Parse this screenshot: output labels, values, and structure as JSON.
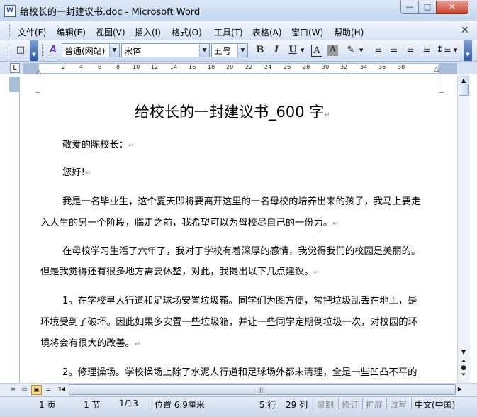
{
  "window": {
    "title": "给校长的一封建议书.doc - Microsoft Word",
    "app_icon": "W",
    "controls": {
      "minimize": "—",
      "maximize": "□",
      "close": "✕"
    }
  },
  "menubar": {
    "items": [
      "文件(F)",
      "编辑(E)",
      "视图(V)",
      "插入(I)",
      "格式(O)",
      "工具(T)",
      "表格(A)",
      "窗口(W)",
      "帮助(H)"
    ],
    "close_doc": "✕"
  },
  "toolbar": {
    "style_value": "普通(网站)",
    "font_value": "宋体",
    "size_value": "五号",
    "new_icon": "□",
    "styles_icon": "A",
    "bold": "B",
    "italic": "I",
    "underline": "U",
    "char_border": "A",
    "char_shading": "A",
    "highlight": "✎",
    "align_left": "≡",
    "align_center": "≡",
    "align_right": "≡",
    "justify": "≡",
    "line_spacing": "↕≡"
  },
  "ruler": {
    "ticks": [
      "2",
      "4",
      "6",
      "8",
      "10",
      "12",
      "14",
      "16",
      "18",
      "20",
      "22",
      "24",
      "26",
      "28",
      "30",
      "32",
      "34",
      "36",
      "38"
    ],
    "corner": "L"
  },
  "document": {
    "title": "给校长的一封建议书_600 字",
    "paragraphs": [
      "敬爱的陈校长：",
      "您好!",
      "我是一名毕业生，这个夏天即将要离开这里的一名母校的培养出来的孩子，我马上要走",
      "入人生的另一个阶段，临走之前，我希望可以为母校尽自己的一份力。",
      "在母校学习生活了六年了，我对于学校有着深厚的感情，我觉得我们的校园是美丽的。",
      "但是我觉得还有很多地方需要休整，对此，我提出以下几点建议。",
      "1。在学校里人行道和足球场安置垃圾箱。同学们为图方便，常把垃圾乱丢在地上，是",
      "环境受到了破坏。因此如果多安置一些垃圾箱，并让一些同学定期倒垃圾一次，对校园的环",
      "境将会有很大的改善。",
      "2。修理操场。学校操场上除了水泥人行道和足球场外都未清理，全是一些凹凸不平的"
    ],
    "para_mark": "↵"
  },
  "statusbar": {
    "page": "1 页",
    "section": "1 节",
    "page_of": "1/13",
    "position": "位置 6.9厘米",
    "line": "5 行",
    "column": "29 列",
    "rec": "录制",
    "trk": "修订",
    "ext": "扩展",
    "ovr": "改写",
    "language": "中文(中国)"
  }
}
